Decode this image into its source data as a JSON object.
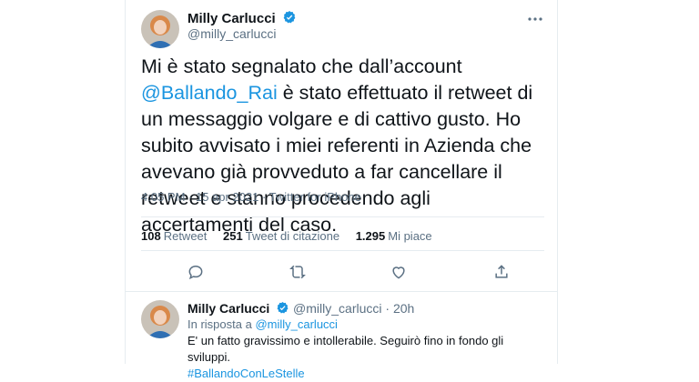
{
  "tweet": {
    "author_name": "Milly Carlucci",
    "author_handle": "@milly_carlucci",
    "text_part1": "Mi è stato segnalato che dall’account ",
    "mention": "@Ballando_Rai",
    "text_part2": " è stato effettuato il retweet di un messaggio volgare e di cattivo gusto.  Ho subito avvisato i miei referenti in Azienda che avevano già provveduto a far cancellare il retweet e stanno procedendo agli accertamenti del caso.",
    "timestamp": "4:05 PM · 15 apr 2021 · Twitter for iPhone"
  },
  "stats": {
    "retweets_count": "108",
    "retweets_label": "Retweet",
    "quotes_count": "251",
    "quotes_label": "Tweet di citazione",
    "likes_count": "1.295",
    "likes_label": "Mi piace"
  },
  "reply": {
    "author_name": "Milly Carlucci",
    "author_handle": "@milly_carlucci",
    "separator": "·",
    "time": "20h",
    "in_reply_prefix": "In risposta a",
    "in_reply_handle": "@milly_carlucci",
    "text": "E' un fatto gravissimo e intollerabile. Seguirò fino in fondo gli sviluppi.",
    "hashtag": "#BallandoConLeStelle"
  },
  "colors": {
    "accent": "#1b95e0",
    "secondary_text": "#5b7083",
    "divider": "#e6ecf0"
  },
  "icons": [
    "verified-badge-icon",
    "more-icon",
    "reply-icon",
    "retweet-icon",
    "like-icon",
    "share-icon"
  ]
}
